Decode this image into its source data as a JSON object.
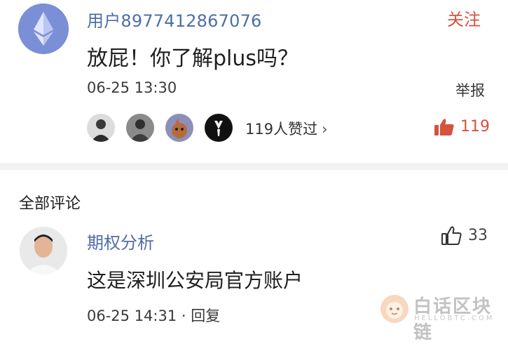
{
  "post": {
    "username": "用户8977412867076",
    "follow_label": "关注",
    "text": "放屁！你了解plus吗？",
    "time": "06-25 13:30",
    "report_label": "举报",
    "liked_by_text": "119人赞过",
    "liked_by_chevron": "›",
    "like_count": "119"
  },
  "comments_section": {
    "title": "全部评论"
  },
  "comment": {
    "username": "期权分析",
    "like_count": "33",
    "text": "这是深圳公安局官方账户",
    "time": "06-25 14:31",
    "separator": "·",
    "reply_label": "回复"
  },
  "watermark": {
    "title": "白话区块链",
    "subtitle": "HELLOBTC.COM"
  },
  "colors": {
    "username_blue": "#4f6ea8",
    "accent_red": "#d5533e"
  }
}
